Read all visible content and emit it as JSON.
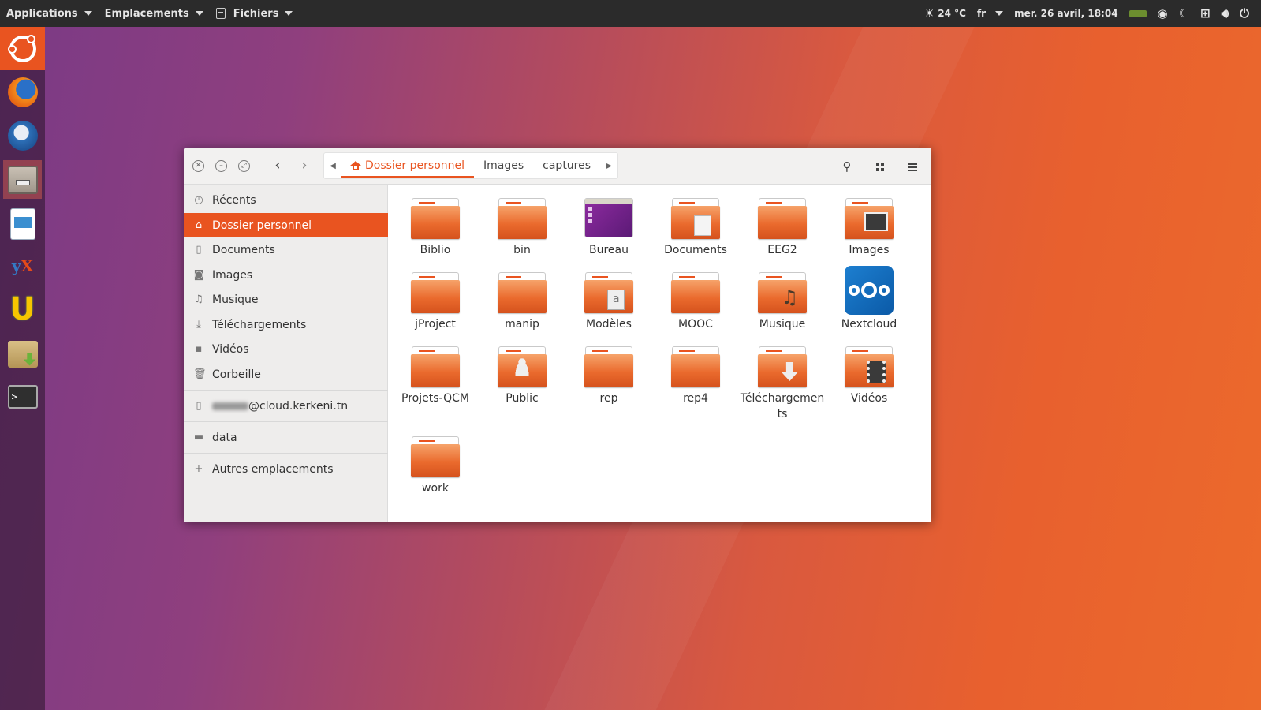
{
  "top_panel": {
    "menus": [
      {
        "label": "Applications"
      },
      {
        "label": "Emplacements"
      },
      {
        "label": "Fichiers"
      }
    ],
    "weather": "24 °C",
    "language": "fr",
    "datetime": "mer. 26 avril, 18:04"
  },
  "launcher": {
    "items": [
      "ubuntu-dash",
      "firefox",
      "thunderbird",
      "files",
      "libreoffice-writer",
      "yx",
      "u-app",
      "archive-manager",
      "terminal"
    ]
  },
  "window": {
    "path": {
      "crumbs": [
        {
          "label": "Dossier personnel"
        },
        {
          "label": "Images"
        },
        {
          "label": "captures"
        }
      ]
    },
    "sidebar": {
      "places": [
        {
          "label": "Récents",
          "icon": "clock-icon"
        },
        {
          "label": "Dossier personnel",
          "icon": "home-icon"
        },
        {
          "label": "Documents",
          "icon": "document-icon"
        },
        {
          "label": "Images",
          "icon": "camera-icon"
        },
        {
          "label": "Musique",
          "icon": "music-icon"
        },
        {
          "label": "Téléchargements",
          "icon": "download-icon"
        },
        {
          "label": "Vidéos",
          "icon": "video-icon"
        },
        {
          "label": "Corbeille",
          "icon": "trash-icon"
        }
      ],
      "network_account": "@cloud.kerkeni.tn",
      "drive": "data",
      "other_locations": "Autres emplacements"
    },
    "files": [
      {
        "label": "Biblio"
      },
      {
        "label": "bin"
      },
      {
        "label": "Bureau"
      },
      {
        "label": "Documents"
      },
      {
        "label": "EEG2"
      },
      {
        "label": "Images"
      },
      {
        "label": "jProject"
      },
      {
        "label": "manip"
      },
      {
        "label": "Modèles"
      },
      {
        "label": "MOOC"
      },
      {
        "label": "Musique"
      },
      {
        "label": "Nextcloud"
      },
      {
        "label": "Projets-QCM"
      },
      {
        "label": "Public"
      },
      {
        "label": "rep"
      },
      {
        "label": "rep4"
      },
      {
        "label": "Téléchargements"
      },
      {
        "label": "Vidéos"
      },
      {
        "label": "work"
      }
    ]
  },
  "colors": {
    "accent": "#e95420",
    "panel": "#2b2b2b"
  }
}
